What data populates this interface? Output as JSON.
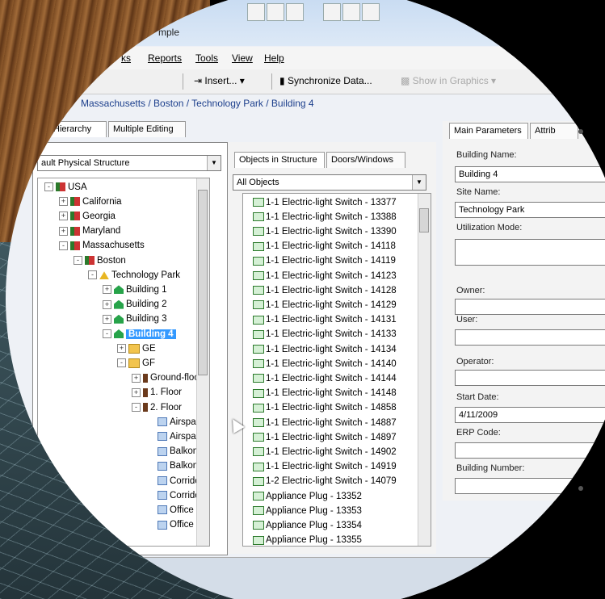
{
  "window": {
    "title": "mple"
  },
  "menu": {
    "items": [
      "ks",
      "Reports",
      "Tools",
      "View",
      "Help"
    ]
  },
  "toolbar": {
    "insert": "Insert...",
    "sync": "Synchronize Data...",
    "show": "Show in Graphics"
  },
  "breadcrumb": "Massachusetts / Boston / Technology Park / Building 4",
  "left_tabs": [
    "Hierarchy",
    "Multiple Editing"
  ],
  "structure_select": "ault Physical Structure",
  "tree": [
    {
      "label": "USA",
      "icon": "flag-icon"
    },
    {
      "label": "California",
      "icon": "flag-icon"
    },
    {
      "label": "Georgia",
      "icon": "flag-icon"
    },
    {
      "label": "Maryland",
      "icon": "flag-icon"
    },
    {
      "label": "Massachusetts",
      "icon": "flag-icon"
    },
    {
      "label": "Boston",
      "icon": "flag-icon"
    },
    {
      "label": "Technology Park",
      "icon": "site-icon"
    },
    {
      "label": "Building 1",
      "icon": "building-icon"
    },
    {
      "label": "Building 2",
      "icon": "building-icon"
    },
    {
      "label": "Building 3",
      "icon": "building-icon"
    },
    {
      "label": "Building 4",
      "icon": "building-icon",
      "selected": true
    },
    {
      "label": "GE",
      "icon": "building-part-icon"
    },
    {
      "label": "GF",
      "icon": "building-part-icon"
    },
    {
      "label": "Ground-floor",
      "icon": "floor-icon"
    },
    {
      "label": "1. Floor",
      "icon": "floor-icon"
    },
    {
      "label": "2. Floor",
      "icon": "floor-icon"
    },
    {
      "label": "Airspace -",
      "icon": "room-icon"
    },
    {
      "label": "Airspace -",
      "icon": "room-icon"
    },
    {
      "label": "Balkon - C",
      "icon": "room-icon"
    },
    {
      "label": "Balkon - C",
      "icon": "room-icon"
    },
    {
      "label": "Corridor - I",
      "icon": "room-icon"
    },
    {
      "label": "Corridor - I",
      "icon": "room-icon"
    },
    {
      "label": "Office - GI",
      "icon": "room-icon"
    },
    {
      "label": "Office - GI",
      "icon": "room-icon"
    }
  ],
  "mid_tabs": [
    "Objects in Structure",
    "Doors/Windows"
  ],
  "objects_filter": "All Objects",
  "objects": [
    "1-1 Electric-light Switch - 13377",
    "1-1 Electric-light Switch - 13388",
    "1-1 Electric-light Switch - 13390",
    "1-1 Electric-light Switch - 14118",
    "1-1 Electric-light Switch - 14119",
    "1-1 Electric-light Switch - 14123",
    "1-1 Electric-light Switch - 14128",
    "1-1 Electric-light Switch - 14129",
    "1-1 Electric-light Switch - 14131",
    "1-1 Electric-light Switch - 14133",
    "1-1 Electric-light Switch - 14134",
    "1-1 Electric-light Switch - 14140",
    "1-1 Electric-light Switch - 14144",
    "1-1 Electric-light Switch - 14148",
    "1-1 Electric-light Switch - 14858",
    "1-1 Electric-light Switch - 14887",
    "1-1 Electric-light Switch - 14897",
    "1-1 Electric-light Switch - 14902",
    "1-1 Electric-light Switch - 14919",
    "1-2 Electric-light Switch - 14079",
    "Appliance Plug - 13352",
    "Appliance Plug - 13353",
    "Appliance Plug - 13354",
    "Appliance Plug - 13355"
  ],
  "right_tabs": [
    "Main Parameters",
    "Attrib"
  ],
  "fields": [
    {
      "label": "Building Name:",
      "value": "Building 4"
    },
    {
      "label": "Site Name:",
      "value": "Technology Park"
    },
    {
      "label": "Utilization Mode:",
      "value": "",
      "tall": true
    },
    {
      "label": "Owner:",
      "value": ""
    },
    {
      "label": "User:",
      "value": ""
    },
    {
      "label": "Operator:",
      "value": ""
    },
    {
      "label": "Start Date:",
      "value": "4/11/2009"
    },
    {
      "label": "ERP Code:",
      "value": ""
    },
    {
      "label": "Building Number:",
      "value": ""
    }
  ],
  "colors": {
    "selection": "#3399ff",
    "breadcrumb": "#1c3f8c"
  }
}
